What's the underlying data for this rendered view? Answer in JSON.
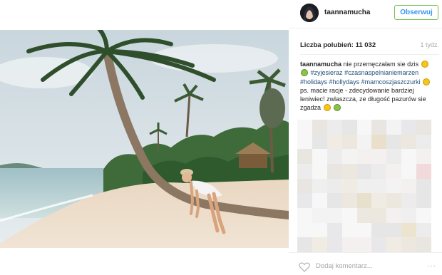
{
  "header": {
    "username": "taannamucha",
    "follow_label": "Obserwuj"
  },
  "stats": {
    "likes": "Liczba polubień: 11 032",
    "time_ago": "1 tydz."
  },
  "caption": {
    "username": "taannamucha",
    "text1": "nie przemęczałam sie dzis",
    "tag1": "#zyjesieraz",
    "tag2": "#czasnaspelnianiemarzen",
    "tag3": "#holidays",
    "tag4": "#hollydays",
    "tag5": "#mamcoszjaszczurki",
    "text2": "ps. macie racje - zdecydowanie bardziej leniwiec! zwlaszcza, ze długość pazurów sie zgadza"
  },
  "comment": {
    "placeholder": "Dodaj komentarz...",
    "more": "···"
  },
  "icons": [
    "heart-icon",
    "more-options-icon",
    "avatar"
  ],
  "colors": {
    "follow_border": "#70c050",
    "follow_text": "#3897f0",
    "hashtag": "#1f4e79",
    "muted": "#a5a7aa"
  }
}
